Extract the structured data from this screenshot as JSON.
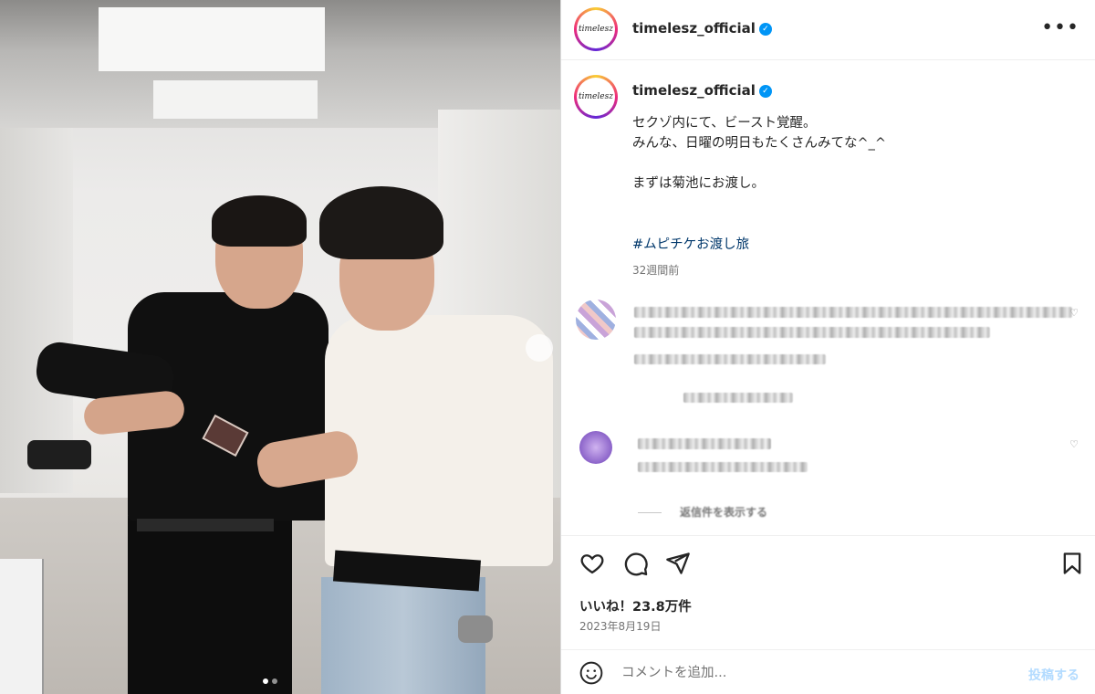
{
  "post": {
    "username": "timelesz_official",
    "avatar_text": "timelesz",
    "more_label": "•••",
    "verified_mark": "✓",
    "caption_lines": "セクゾ内にて、ビースト覚醒。\nみんな、日曜の明日もたくさんみてな^_^\n\nまずは菊池にお渡し。",
    "hashtag": "#ムピチケお渡し旅",
    "time_ago": "32週間前",
    "likes_label": "いいね！23.8万件",
    "date": "2023年8月19日",
    "carousel": {
      "slides": 2,
      "active": 1
    }
  },
  "comments": {
    "reply_link": "返信件を表示する"
  },
  "comment_box": {
    "placeholder": "コメントを追加...",
    "post_label": "投稿する"
  },
  "colors": {
    "verified": "#0095f6",
    "hashtag": "#00376b",
    "post_button": "#b3dbff"
  }
}
